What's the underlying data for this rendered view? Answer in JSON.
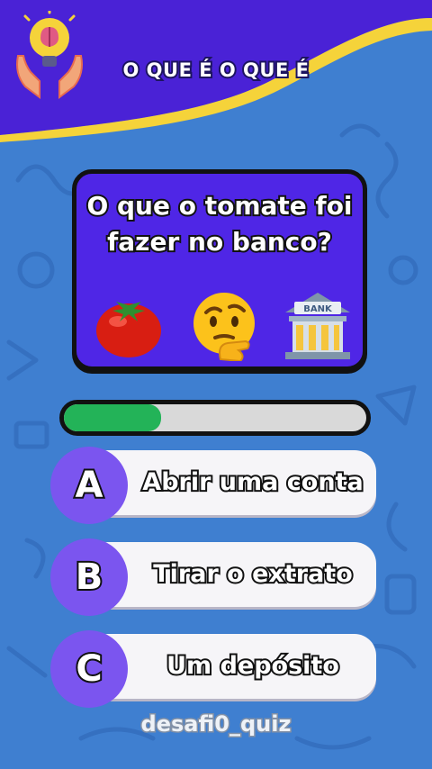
{
  "header": {
    "title": "O QUE É O QUE É",
    "logo_icon": "brain-lightbulb-hands-icon"
  },
  "question": {
    "line1": "O que o tomate foi",
    "line2": "fazer no banco?",
    "emojis": [
      "tomato-icon",
      "thinking-face-icon",
      "bank-icon"
    ],
    "bank_sign": "BANK"
  },
  "progress": {
    "value": 0.32,
    "color": "#23b358"
  },
  "answers": [
    {
      "letter": "A",
      "text": "Abrir uma conta"
    },
    {
      "letter": "B",
      "text": "Tirar o extrato"
    },
    {
      "letter": "C",
      "text": "Um depósito"
    }
  ],
  "watermark": "desafi0_quiz",
  "colors": {
    "background": "#3f7fd0",
    "header": "#4a22d6",
    "wave": "#f5d33a",
    "card": "#4f26e6",
    "badge": "#7b55ef"
  }
}
